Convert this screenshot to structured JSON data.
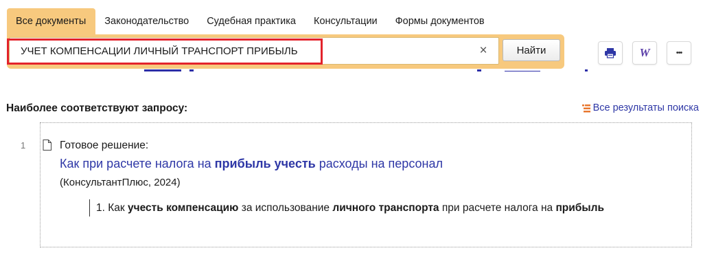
{
  "tabs": [
    {
      "label": "Все документы",
      "active": true
    },
    {
      "label": "Законодательство",
      "active": false
    },
    {
      "label": "Судебная практика",
      "active": false
    },
    {
      "label": "Консультации",
      "active": false
    },
    {
      "label": "Формы документов",
      "active": false
    }
  ],
  "search": {
    "value": "УЧЕТ КОМПЕНСАЦИИ ЛИЧНЫЙ ТРАНСПОРТ ПРИБЫЛЬ",
    "clear_icon": "×",
    "find_label": "Найти"
  },
  "toolbar": {
    "print_icon": "print-icon",
    "word_icon": "W",
    "more_icon": "•••"
  },
  "results": {
    "section_title": "Наиболее соответствуют запросу:",
    "all_results_label": "Все результаты поиска",
    "items": [
      {
        "number": "1",
        "type": "Готовое решение:",
        "title_parts": [
          "Как при расчете налога на ",
          "прибыль учесть",
          " расходы на персонал"
        ],
        "source": "(КонсультантПлюс, 2024)",
        "snippet_parts": [
          "1. Как ",
          "учесть компенсацию",
          " за использование ",
          "личного транспорта",
          " при расчете налога на ",
          "прибыль"
        ]
      }
    ]
  },
  "colors": {
    "accent": "#f7c97e",
    "link": "#2e37a6",
    "highlight": "#e3232b"
  }
}
